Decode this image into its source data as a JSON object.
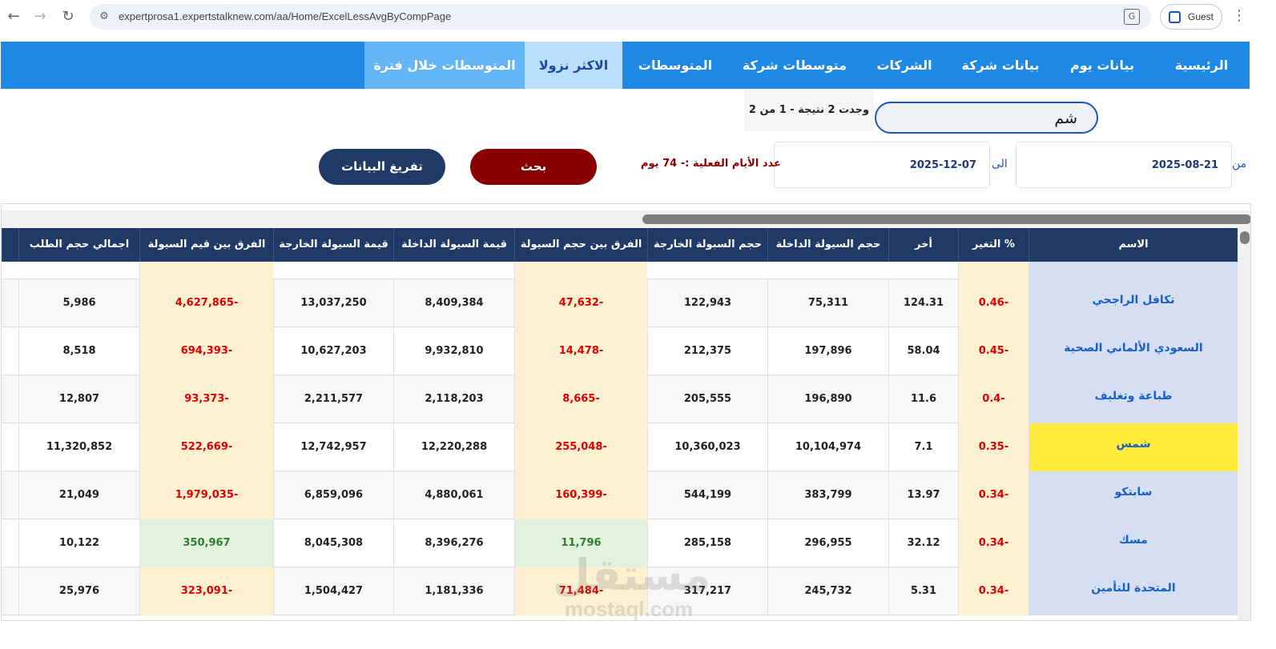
{
  "browser": {
    "url": "expertprosa1.expertstalknew.com/aa/Home/ExcelLessAvgByCompPage",
    "profile_label": "Guest"
  },
  "nav": {
    "items": [
      {
        "label": "الرئيسية"
      },
      {
        "label": "بيانات يوم"
      },
      {
        "label": "بيانات شركة"
      },
      {
        "label": "الشركات"
      },
      {
        "label": "متوسطات شركة"
      },
      {
        "label": "المتوسطات"
      },
      {
        "label": "الاكثر نزولا"
      },
      {
        "label": "المتوسطات خلال فترة"
      }
    ],
    "active": "الاكثر نزولا"
  },
  "search": {
    "value": "شم",
    "result_text": "وجدت 2 نتيجة - 1 من 2"
  },
  "filters": {
    "from_label": "من",
    "from_date": "2025-08-21",
    "to_label": "الى",
    "to_date": "2025-12-07",
    "days_text": "عدد الأيام الفعلية :- 74 يوم",
    "search_button": "بحث",
    "clear_button": "تفريغ البيانات"
  },
  "table": {
    "columns": [
      "الاسم",
      "التغير %",
      "أخر",
      "حجم السيولة الداخلة",
      "حجم السبولة الخارجة",
      "الفرق بين حجم السيولة",
      "قيمة السيولة الداخلة",
      "قيمة السيولة الخارجة",
      "الفرق بين قيم السيولة",
      "اجمالي حجم الطلب"
    ],
    "rows": [
      {
        "name": "تكافل الراجحي",
        "change": "0.46-",
        "last": "124.31",
        "in_vol": "75,311",
        "out_vol": "122,943",
        "vol_diff": "47,632-",
        "in_val": "8,409,384",
        "out_val": "13,037,250",
        "val_diff": "4,627,865-",
        "total": "5,986"
      },
      {
        "name": "السعودي الألماني الصحية",
        "change": "0.45-",
        "last": "58.04",
        "in_vol": "197,896",
        "out_vol": "212,375",
        "vol_diff": "14,478-",
        "in_val": "9,932,810",
        "out_val": "10,627,203",
        "val_diff": "694,393-",
        "total": "8,518"
      },
      {
        "name": "طباعة وتغليف",
        "change": "0.4-",
        "last": "11.6",
        "in_vol": "196,890",
        "out_vol": "205,555",
        "vol_diff": "8,665-",
        "in_val": "2,118,203",
        "out_val": "2,211,577",
        "val_diff": "93,373-",
        "total": "12,807"
      },
      {
        "name": "شمس",
        "change": "0.35-",
        "last": "7.1",
        "in_vol": "10,104,974",
        "out_vol": "10,360,023",
        "vol_diff": "255,048-",
        "in_val": "12,220,288",
        "out_val": "12,742,957",
        "val_diff": "522,669-",
        "total": "11,320,852"
      },
      {
        "name": "سابتكو",
        "change": "0.34-",
        "last": "13.97",
        "in_vol": "383,799",
        "out_vol": "544,199",
        "vol_diff": "160,399-",
        "in_val": "4,880,061",
        "out_val": "6,859,096",
        "val_diff": "1,979,035-",
        "total": "21,049"
      },
      {
        "name": "مسك",
        "change": "0.34-",
        "last": "32.12",
        "in_vol": "296,955",
        "out_vol": "285,158",
        "vol_diff": "11,796",
        "in_val": "8,396,276",
        "out_val": "8,045,308",
        "val_diff": "350,967",
        "total": "10,122"
      },
      {
        "name": "المتحدة للتأمين",
        "change": "0.34-",
        "last": "5.31",
        "in_vol": "245,732",
        "out_vol": "317,217",
        "vol_diff": "71,484-",
        "in_val": "1,181,336",
        "out_val": "1,504,427",
        "val_diff": "323,091-",
        "total": "25,976"
      }
    ],
    "highlighted_row": "شمس"
  },
  "watermark": {
    "arabic": "مستقل",
    "latin": "mostaql.com"
  }
}
